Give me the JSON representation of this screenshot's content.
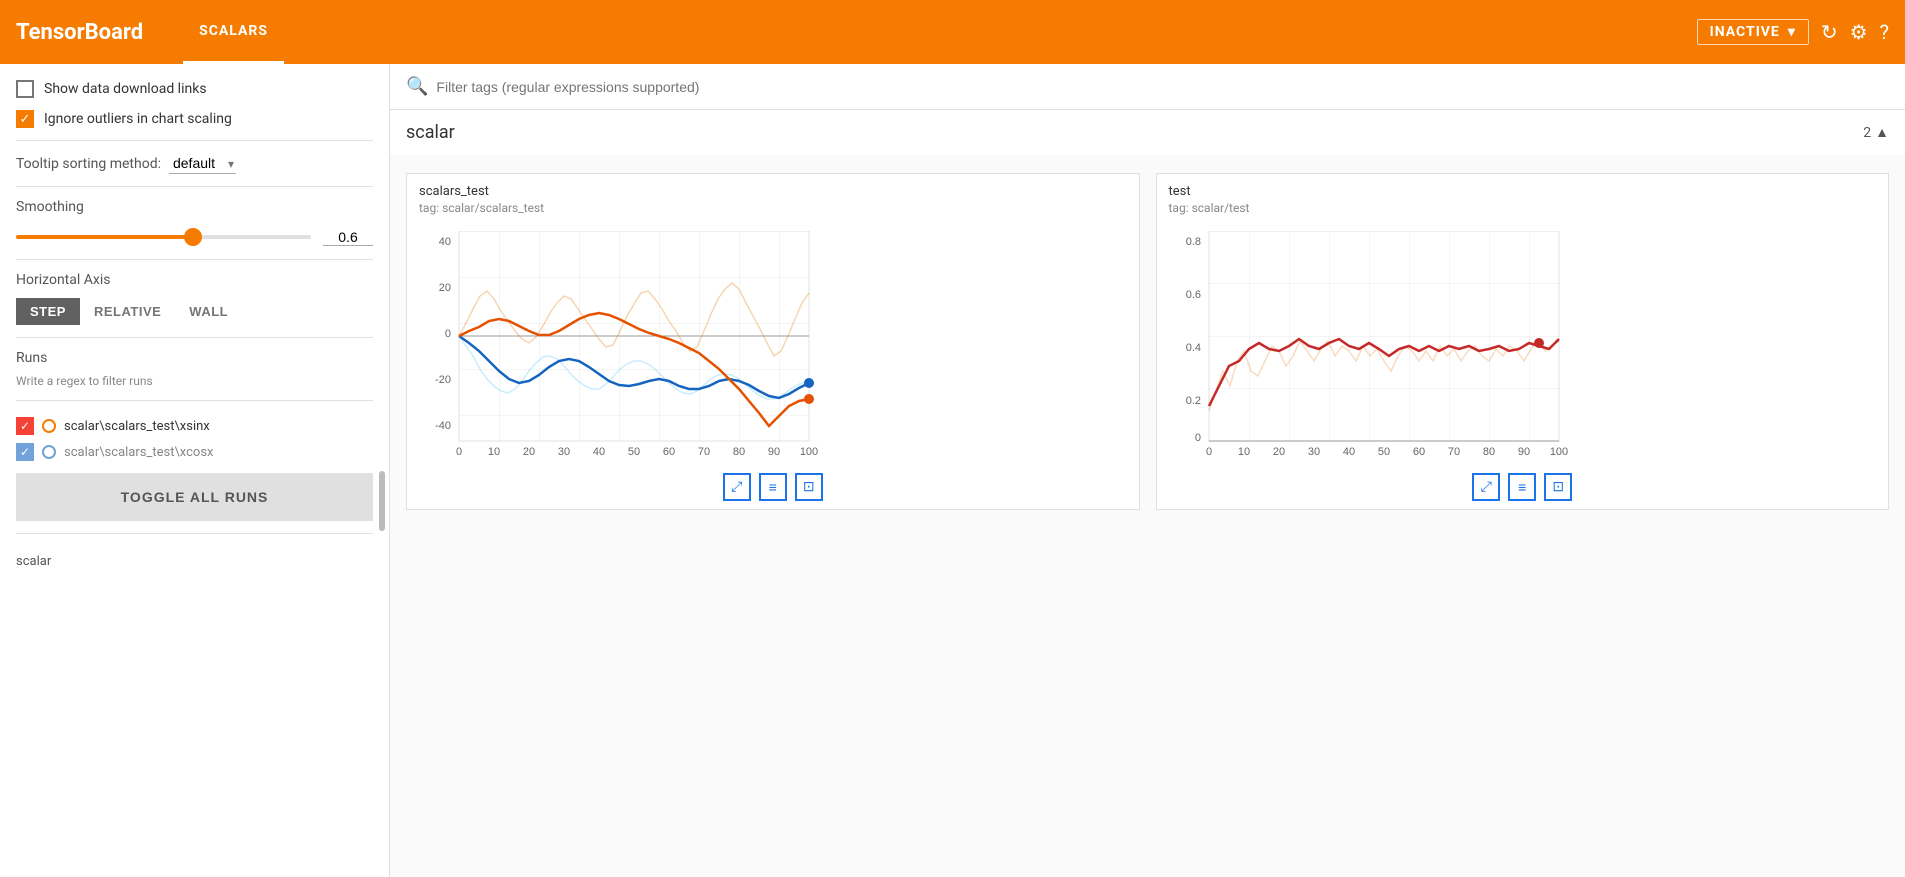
{
  "header": {
    "logo": "TensorBoard",
    "nav_item": "SCALARS",
    "status": "INACTIVE",
    "icons": [
      "refresh",
      "settings",
      "help"
    ]
  },
  "sidebar": {
    "show_download": "Show data download links",
    "ignore_outliers": "Ignore outliers in chart scaling",
    "tooltip_label": "Tooltip sorting method:",
    "tooltip_value": "default",
    "smoothing_label": "Smoothing",
    "smoothing_value": "0.6",
    "horizontal_axis_label": "Horizontal Axis",
    "axis_options": [
      "STEP",
      "RELATIVE",
      "WALL"
    ],
    "axis_active": "STEP",
    "runs_label": "Runs",
    "runs_filter_placeholder": "Write a regex to filter runs",
    "runs": [
      {
        "name": "scalar\\scalars_test\\xsinx",
        "color": "orange",
        "checked": true
      },
      {
        "name": "scalar\\scalars_test\\xcosx",
        "color": "blue",
        "checked": true
      }
    ],
    "toggle_all": "TOGGLE ALL RUNS",
    "footer": "scalar"
  },
  "filter_bar": {
    "placeholder": "Filter tags (regular expressions supported)"
  },
  "section": {
    "name": "scalar",
    "count": "2"
  },
  "charts": [
    {
      "id": "chart1",
      "title": "scalars_test",
      "tag": "tag: scalar/scalars_test",
      "x_min": 0,
      "x_max": 100,
      "y_min": -40,
      "y_max": 40
    },
    {
      "id": "chart2",
      "title": "test",
      "tag": "tag: scalar/test",
      "x_min": 0,
      "x_max": 100,
      "y_min": 0,
      "y_max": 0.8
    }
  ]
}
